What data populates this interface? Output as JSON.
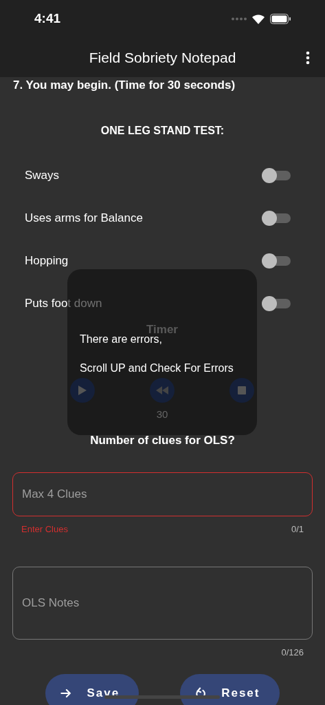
{
  "status_bar": {
    "time": "4:41"
  },
  "app_bar": {
    "title": "Field Sobriety Notepad"
  },
  "instruction": "7. You may begin. (Time for 30 seconds)",
  "section_title": "ONE LEG STAND TEST:",
  "clues": [
    {
      "label": "Sways",
      "on": false
    },
    {
      "label": "Uses arms for Balance",
      "on": false
    },
    {
      "label": "Hopping",
      "on": false
    },
    {
      "label": "Puts foot down",
      "on": false
    }
  ],
  "timer": {
    "title": "Timer",
    "value": "30"
  },
  "toast": {
    "lines": [
      "There are errors,",
      "Scroll UP and Check For Errors"
    ]
  },
  "question": "Number of clues for OLS?",
  "clues_field": {
    "placeholder": "Max 4 Clues",
    "error": "Enter Clues",
    "counter": "0/1"
  },
  "notes_field": {
    "placeholder": "OLS Notes",
    "counter": "0/126"
  },
  "buttons": [
    {
      "kind": "save",
      "label": "Save"
    },
    {
      "kind": "reset",
      "label": "Reset"
    }
  ]
}
